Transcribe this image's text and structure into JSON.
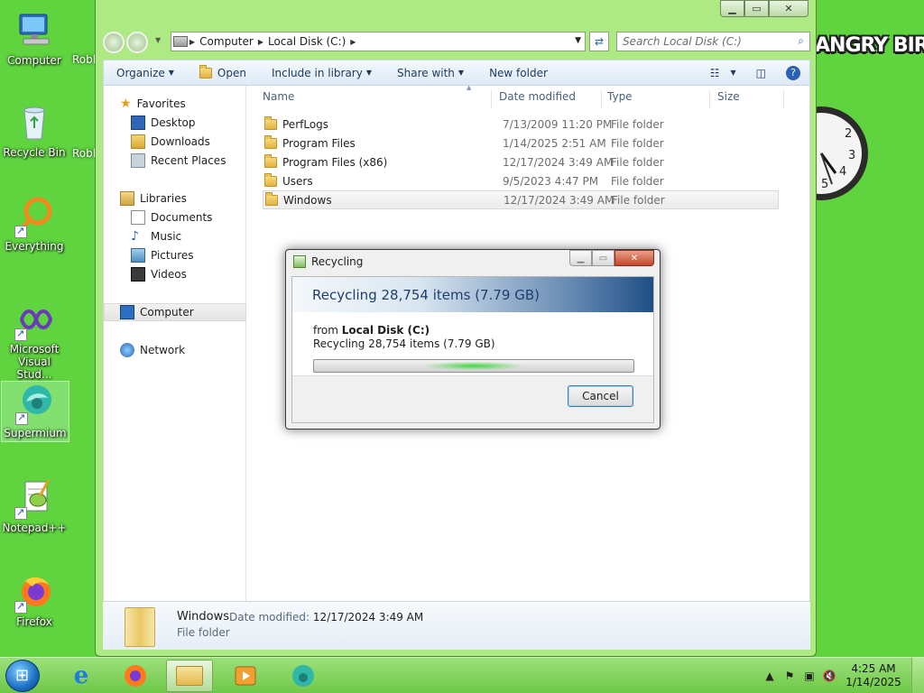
{
  "desktop": {
    "icons": [
      {
        "label": "Computer",
        "icon": "computer-icon"
      },
      {
        "label": "Recycle Bin",
        "icon": "recycle-bin-icon"
      },
      {
        "label": "Everything",
        "icon": "everything-search-icon"
      },
      {
        "label": "Microsoft Visual Stud...",
        "icon": "visual-studio-icon"
      },
      {
        "label": "Supermium",
        "icon": "supermium-browser-icon"
      },
      {
        "label": "Notepad++",
        "icon": "notepadpp-icon"
      },
      {
        "label": "Firefox",
        "icon": "firefox-icon"
      }
    ],
    "partial_labels": [
      "Robl",
      "Robl"
    ],
    "logo_text": "ANGRY BIRDS"
  },
  "explorer": {
    "breadcrumb": [
      "Computer",
      "Local Disk (C:)"
    ],
    "search_placeholder": "Search Local Disk (C:)",
    "toolbar": {
      "organize": "Organize",
      "open": "Open",
      "include_in_library": "Include in library",
      "share_with": "Share with",
      "new_folder": "New folder"
    },
    "nav": {
      "favorites": "Favorites",
      "desktop": "Desktop",
      "downloads": "Downloads",
      "recent_places": "Recent Places",
      "libraries": "Libraries",
      "documents": "Documents",
      "music": "Music",
      "pictures": "Pictures",
      "videos": "Videos",
      "computer": "Computer",
      "network": "Network"
    },
    "columns": {
      "name": "Name",
      "date_modified": "Date modified",
      "type": "Type",
      "size": "Size"
    },
    "files": [
      {
        "name": "PerfLogs",
        "date": "7/13/2009 11:20 PM",
        "type": "File folder"
      },
      {
        "name": "Program Files",
        "date": "1/14/2025 2:51 AM",
        "type": "File folder"
      },
      {
        "name": "Program Files (x86)",
        "date": "12/17/2024 3:49 AM",
        "type": "File folder"
      },
      {
        "name": "Users",
        "date": "9/5/2023 4:47 PM",
        "type": "File folder"
      },
      {
        "name": "Windows",
        "date": "12/17/2024 3:49 AM",
        "type": "File folder"
      }
    ],
    "details": {
      "name": "Windows",
      "date_label": "Date modified:",
      "date_value": "12/17/2024 3:49 AM",
      "type": "File folder"
    }
  },
  "dialog": {
    "title": "Recycling",
    "header": "Recycling 28,754 items (7.79 GB)",
    "from_label": "from",
    "from_value": "Local Disk (C:)",
    "status": "Recycling 28,754 items (7.79 GB)",
    "cancel": "Cancel"
  },
  "taskbar": {
    "time": "4:25 AM",
    "date": "1/14/2025",
    "apps": [
      "internet-explorer-icon",
      "firefox-icon",
      "file-explorer-icon",
      "media-player-icon",
      "supermium-browser-icon"
    ]
  }
}
